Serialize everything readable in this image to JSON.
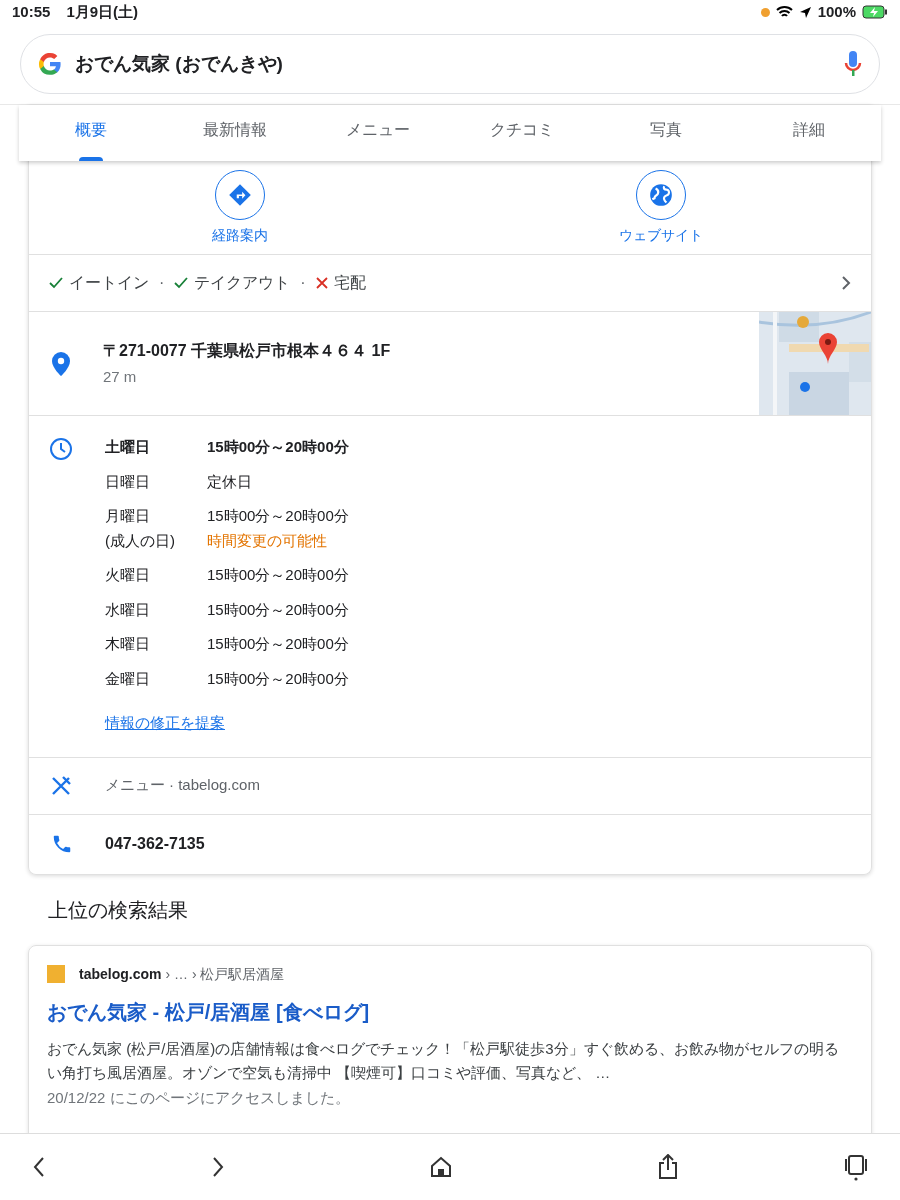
{
  "status_bar": {
    "time": "10:55",
    "date": "1月9日(土)",
    "battery": "100%"
  },
  "search": {
    "value": "おでん気家 (おでんきや)"
  },
  "tabs": [
    {
      "label": "概要",
      "selected": true
    },
    {
      "label": "最新情報",
      "selected": false
    },
    {
      "label": "メニュー",
      "selected": false
    },
    {
      "label": "クチコミ",
      "selected": false
    },
    {
      "label": "写真",
      "selected": false
    },
    {
      "label": "詳細",
      "selected": false
    }
  ],
  "actions": [
    {
      "kind": "directions",
      "label": "経路案内"
    },
    {
      "kind": "website",
      "label": "ウェブサイト"
    }
  ],
  "services_separator": "·",
  "services": [
    {
      "label": "イートイン",
      "available": true
    },
    {
      "label": "テイクアウト",
      "available": true
    },
    {
      "label": "宅配",
      "available": false
    }
  ],
  "address": {
    "text": "〒271-0077 千葉県松戸市根本４６４ 1F",
    "distance": "27 m"
  },
  "hours": [
    {
      "day": "土曜日",
      "time": "15時00分～20時00分",
      "today": true
    },
    {
      "day": "日曜日",
      "time": "定休日",
      "today": false
    },
    {
      "day": "月曜日",
      "note": "(成人の日)",
      "time": "15時00分～20時00分",
      "warning": "時間変更の可能性",
      "today": false
    },
    {
      "day": "火曜日",
      "time": "15時00分～20時00分",
      "today": false
    },
    {
      "day": "水曜日",
      "time": "15時00分～20時00分",
      "today": false
    },
    {
      "day": "木曜日",
      "time": "15時00分～20時00分",
      "today": false
    },
    {
      "day": "金曜日",
      "time": "15時00分～20時00分",
      "today": false
    }
  ],
  "suggest_edit": "情報の修正を提案",
  "menu": {
    "label": "メニュー",
    "source": "· tabelog.com"
  },
  "phone": "047-362-7135",
  "results_heading": "上位の検索結果",
  "result": {
    "site": "tabelog.com",
    "breadcrumb": "› … › 松戸駅居酒屋",
    "title": "おでん気家 - 松戸/居酒屋 [食べログ]",
    "snippet": "おでん気家 (松戸/居酒屋)の店舗情報は食べログでチェック！「松戸駅徒歩3分」すぐ飲める、お飲み物がセルフの明るい角打ち風居酒屋。オゾンで空気も清掃中 【喫煙可】口コミや評価、写真など、 …",
    "visited": "20/12/22 にこのページにアクセスしました。"
  }
}
